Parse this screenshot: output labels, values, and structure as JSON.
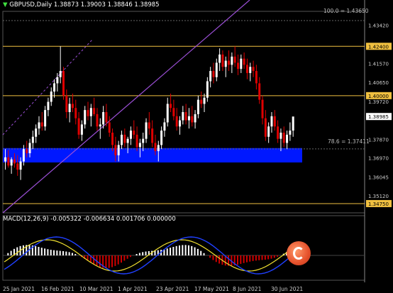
{
  "header": {
    "symbol": "GBPUSD,Daily",
    "ohlc": "1.38873 1.39003 1.38846 1.38985"
  },
  "macd_header": "MACD(12,26,9) -0.005322 -0.006634 0.001706 0.000000",
  "fib_labels": {
    "top": "100.0 = 1.43650",
    "mid": "78.6 = 1.37411"
  },
  "colors": {
    "background": "#000000",
    "grid": "#3a3a3a",
    "bull": "#ffffff",
    "bear": "#e00000",
    "level_line": "#f0c040",
    "channel": "#9b4fd6",
    "zone": "#0018ff",
    "price_tag": "#ffffff",
    "signal": "#f0e030",
    "macd_line": "#2040ff",
    "hist_pos": "#ffffff",
    "hist_neg": "#d00000"
  },
  "chart_data": {
    "type": "candlestick",
    "symbol": "GBPUSD",
    "timeframe": "Daily",
    "price_axis_ticks": [
      1.4342,
      1.4157,
      1.4065,
      1.3972,
      1.3787,
      1.3697,
      1.3604,
      1.3512
    ],
    "highlighted_levels": [
      1.424,
      1.4,
      1.38985,
      1.3475
    ],
    "level_labels": [
      "1.42400",
      "1.40000",
      "1.38985",
      "1.34750"
    ],
    "price_axis_labels": [
      "1.43420",
      "1.41570",
      "1.40650",
      "1.39720",
      "1.37870",
      "1.36970",
      "1.36045",
      "1.35120"
    ],
    "ylim": [
      1.343,
      1.441
    ],
    "fib_levels": [
      {
        "label": "100.0",
        "value": 1.4365
      },
      {
        "label": "78.6",
        "value": 1.37411
      }
    ],
    "support_zone": [
      1.3675,
      1.3745
    ],
    "date_labels": [
      "25 Jan 2021",
      "16 Feb 2021",
      "10 Mar 2021",
      "1 Apr 2021",
      "23 Apr 2021",
      "17 May 2021",
      "8 Jun 2021",
      "30 Jun 2021"
    ],
    "candles": [
      [
        1.368,
        1.374,
        1.364,
        1.37
      ],
      [
        1.37,
        1.3735,
        1.365,
        1.366
      ],
      [
        1.366,
        1.37,
        1.362,
        1.369
      ],
      [
        1.369,
        1.372,
        1.365,
        1.367
      ],
      [
        1.367,
        1.371,
        1.361,
        1.364
      ],
      [
        1.364,
        1.37,
        1.359,
        1.368
      ],
      [
        1.368,
        1.376,
        1.366,
        1.374
      ],
      [
        1.374,
        1.378,
        1.37,
        1.372
      ],
      [
        1.372,
        1.379,
        1.37,
        1.377
      ],
      [
        1.377,
        1.383,
        1.374,
        1.38
      ],
      [
        1.38,
        1.386,
        1.377,
        1.384
      ],
      [
        1.384,
        1.39,
        1.381,
        1.387
      ],
      [
        1.387,
        1.392,
        1.383,
        1.385
      ],
      [
        1.385,
        1.395,
        1.383,
        1.393
      ],
      [
        1.393,
        1.399,
        1.39,
        1.397
      ],
      [
        1.397,
        1.404,
        1.395,
        1.402
      ],
      [
        1.402,
        1.408,
        1.399,
        1.406
      ],
      [
        1.406,
        1.411,
        1.402,
        1.409
      ],
      [
        1.409,
        1.424,
        1.406,
        1.412
      ],
      [
        1.412,
        1.414,
        1.398,
        1.4
      ],
      [
        1.4,
        1.403,
        1.389,
        1.392
      ],
      [
        1.392,
        1.399,
        1.387,
        1.396
      ],
      [
        1.396,
        1.401,
        1.392,
        1.394
      ],
      [
        1.394,
        1.398,
        1.386,
        1.389
      ],
      [
        1.389,
        1.392,
        1.379,
        1.381
      ],
      [
        1.381,
        1.388,
        1.378,
        1.386
      ],
      [
        1.386,
        1.395,
        1.384,
        1.393
      ],
      [
        1.393,
        1.397,
        1.388,
        1.39
      ],
      [
        1.39,
        1.396,
        1.385,
        1.394
      ],
      [
        1.394,
        1.399,
        1.39,
        1.391
      ],
      [
        1.391,
        1.394,
        1.383,
        1.385
      ],
      [
        1.385,
        1.389,
        1.379,
        1.386
      ],
      [
        1.386,
        1.395,
        1.384,
        1.392
      ],
      [
        1.392,
        1.396,
        1.385,
        1.387
      ],
      [
        1.387,
        1.39,
        1.38,
        1.382
      ],
      [
        1.382,
        1.384,
        1.373,
        1.376
      ],
      [
        1.376,
        1.38,
        1.368,
        1.371
      ],
      [
        1.371,
        1.378,
        1.368,
        1.376
      ],
      [
        1.376,
        1.383,
        1.374,
        1.381
      ],
      [
        1.381,
        1.384,
        1.375,
        1.377
      ],
      [
        1.377,
        1.38,
        1.372,
        1.379
      ],
      [
        1.379,
        1.385,
        1.376,
        1.383
      ],
      [
        1.383,
        1.388,
        1.379,
        1.381
      ],
      [
        1.381,
        1.385,
        1.373,
        1.375
      ],
      [
        1.375,
        1.379,
        1.37,
        1.377
      ],
      [
        1.377,
        1.382,
        1.373,
        1.379
      ],
      [
        1.379,
        1.389,
        1.377,
        1.387
      ],
      [
        1.387,
        1.392,
        1.381,
        1.384
      ],
      [
        1.384,
        1.388,
        1.375,
        1.377
      ],
      [
        1.377,
        1.381,
        1.371,
        1.373
      ],
      [
        1.373,
        1.378,
        1.368,
        1.376
      ],
      [
        1.376,
        1.385,
        1.374,
        1.383
      ],
      [
        1.383,
        1.389,
        1.38,
        1.387
      ],
      [
        1.387,
        1.399,
        1.385,
        1.396
      ],
      [
        1.396,
        1.401,
        1.392,
        1.394
      ],
      [
        1.394,
        1.398,
        1.388,
        1.39
      ],
      [
        1.39,
        1.394,
        1.383,
        1.385
      ],
      [
        1.385,
        1.39,
        1.381,
        1.388
      ],
      [
        1.388,
        1.395,
        1.386,
        1.392
      ],
      [
        1.392,
        1.396,
        1.386,
        1.388
      ],
      [
        1.388,
        1.394,
        1.384,
        1.39
      ],
      [
        1.39,
        1.395,
        1.385,
        1.387
      ],
      [
        1.387,
        1.393,
        1.384,
        1.391
      ],
      [
        1.391,
        1.4,
        1.389,
        1.398
      ],
      [
        1.398,
        1.402,
        1.394,
        1.396
      ],
      [
        1.396,
        1.401,
        1.392,
        1.399
      ],
      [
        1.399,
        1.409,
        1.397,
        1.407
      ],
      [
        1.407,
        1.414,
        1.404,
        1.412
      ],
      [
        1.412,
        1.416,
        1.406,
        1.409
      ],
      [
        1.409,
        1.418,
        1.407,
        1.416
      ],
      [
        1.416,
        1.423,
        1.412,
        1.42
      ],
      [
        1.42,
        1.422,
        1.412,
        1.414
      ],
      [
        1.414,
        1.419,
        1.409,
        1.417
      ],
      [
        1.417,
        1.422,
        1.412,
        1.415
      ],
      [
        1.415,
        1.421,
        1.411,
        1.419
      ],
      [
        1.419,
        1.424,
        1.414,
        1.416
      ],
      [
        1.416,
        1.42,
        1.41,
        1.413
      ],
      [
        1.413,
        1.42,
        1.411,
        1.418
      ],
      [
        1.418,
        1.421,
        1.413,
        1.415
      ],
      [
        1.415,
        1.418,
        1.408,
        1.411
      ],
      [
        1.411,
        1.416,
        1.407,
        1.414
      ],
      [
        1.414,
        1.417,
        1.409,
        1.412
      ],
      [
        1.412,
        1.415,
        1.403,
        1.406
      ],
      [
        1.406,
        1.409,
        1.396,
        1.398
      ],
      [
        1.398,
        1.4,
        1.386,
        1.389
      ],
      [
        1.389,
        1.393,
        1.378,
        1.38
      ],
      [
        1.38,
        1.387,
        1.377,
        1.385
      ],
      [
        1.385,
        1.392,
        1.382,
        1.39
      ],
      [
        1.39,
        1.393,
        1.383,
        1.385
      ],
      [
        1.385,
        1.388,
        1.377,
        1.379
      ],
      [
        1.379,
        1.384,
        1.373,
        1.382
      ],
      [
        1.382,
        1.385,
        1.375,
        1.377
      ],
      [
        1.377,
        1.383,
        1.374,
        1.381
      ],
      [
        1.381,
        1.387,
        1.378,
        1.383
      ],
      [
        1.383,
        1.389,
        1.38,
        1.38985
      ]
    ]
  }
}
